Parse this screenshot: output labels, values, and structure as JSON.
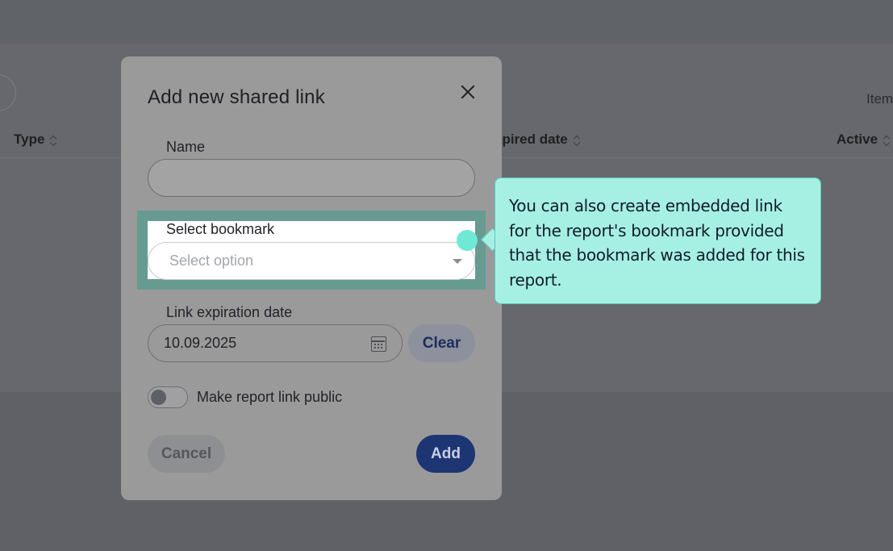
{
  "background": {
    "items_label": "Item",
    "columns": [
      "Type",
      "xpired date",
      "Active"
    ]
  },
  "modal": {
    "title": "Add new shared link",
    "name_label": "Name",
    "name_value": "",
    "bookmark_label": "Select bookmark",
    "bookmark_placeholder": "Select option",
    "expiration_label": "Link expiration date",
    "expiration_value": "10.09.2025",
    "clear_label": "Clear",
    "public_toggle_label": "Make report link public",
    "public_toggle_on": false,
    "cancel_label": "Cancel",
    "add_label": "Add"
  },
  "tooltip": {
    "text": "You can also create embedded link for the report's bookmark provided that the bookmark was added for this report."
  },
  "icons": {
    "close": "close-icon",
    "caret": "chevron-down-icon",
    "calendar": "calendar-icon",
    "sort": "sort-icon"
  },
  "colors": {
    "primary": "#1e3574",
    "tooltip_bg": "#a6f0e3",
    "highlight": "#679b91"
  }
}
